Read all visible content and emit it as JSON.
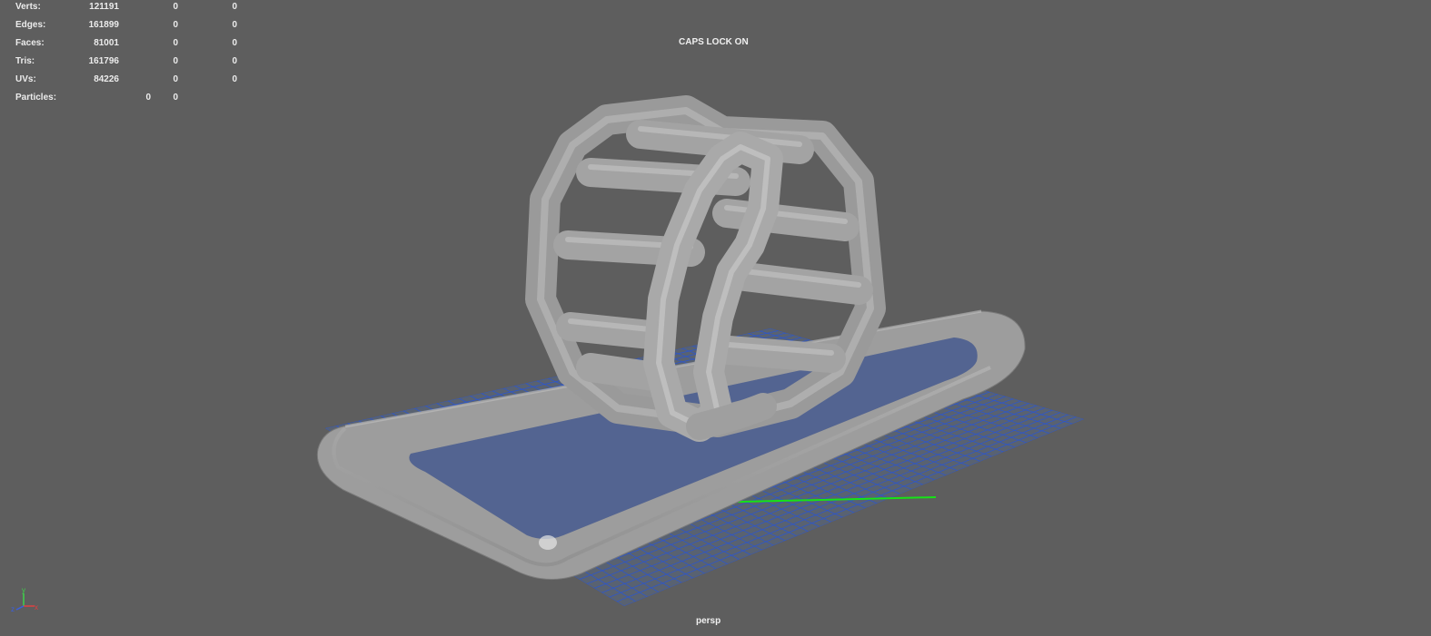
{
  "heads_up": {
    "rows": [
      {
        "label": "Verts:",
        "v1": "121191",
        "v2": "0",
        "v3": "0"
      },
      {
        "label": "Edges:",
        "v1": "161899",
        "v2": "0",
        "v3": "0"
      },
      {
        "label": "Faces:",
        "v1": "81001",
        "v2": "0",
        "v3": "0"
      },
      {
        "label": "Tris:",
        "v1": "161796",
        "v2": "0",
        "v3": "0"
      },
      {
        "label": "UVs:",
        "v1": "84226",
        "v2": "0",
        "v3": "0"
      }
    ],
    "particles": {
      "label": "Particles:",
      "v1": "0",
      "v2": "0"
    }
  },
  "status": {
    "caps_lock": "CAPS LOCK ON"
  },
  "camera": {
    "name": "persp"
  },
  "axis_indicator": {
    "x": "x",
    "y": "y",
    "z": "z"
  },
  "colors": {
    "viewport_bg": "#5e5e5e",
    "grid": "#2f57c9",
    "grid_axis": "#16e316",
    "mesh": "#a6a6a6",
    "text": "#ececec"
  },
  "scene": {
    "objects": [
      "inflatable-roller-wheel",
      "inflatable-pool-ring",
      "ground-grid"
    ]
  }
}
